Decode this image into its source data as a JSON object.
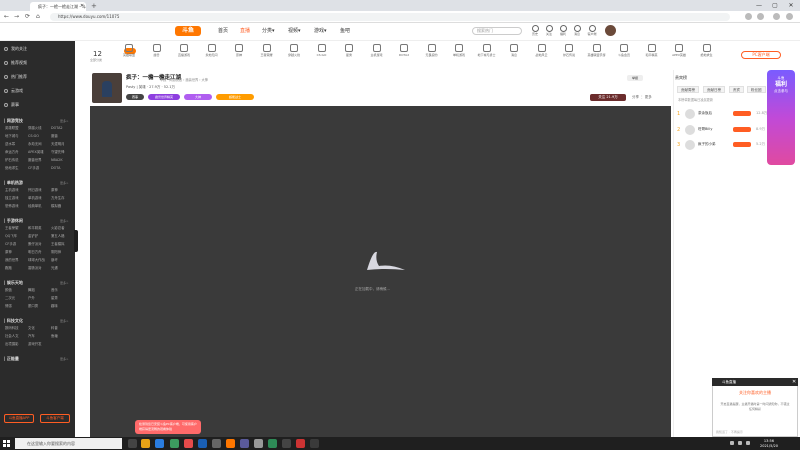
{
  "browser": {
    "tab_title": "疯子：一檐一檐走江湖 - 斗鱼直播",
    "new_tab_label": "+",
    "url": "https://www.douyu.com/11075",
    "window_controls": [
      "—",
      "▢",
      "✕"
    ],
    "nav": [
      "←",
      "→",
      "⟳",
      "⌂"
    ]
  },
  "header": {
    "logo": "斗鱼",
    "nav": [
      {
        "label": "首页",
        "active": false
      },
      {
        "label": "直播",
        "active": true
      },
      {
        "label": "分类▾",
        "active": false
      },
      {
        "label": "视频▾",
        "active": false
      },
      {
        "label": "游戏▾",
        "active": false
      },
      {
        "label": "鱼吧",
        "active": false
      }
    ],
    "search_placeholder": "搜索热门",
    "icons": [
      {
        "icon": "history-icon",
        "label": "历史"
      },
      {
        "icon": "follow-icon",
        "label": "关注"
      },
      {
        "icon": "gift-icon",
        "label": "福利"
      },
      {
        "icon": "message-icon",
        "label": "消息"
      },
      {
        "icon": "download-icon",
        "label": "客户端"
      },
      {
        "icon": "upload-icon",
        "label": "创作中心"
      }
    ]
  },
  "sidebar": {
    "top": [
      "我的关注",
      "推荐视频",
      "热门推荐",
      "云游戏",
      "赛事"
    ],
    "sections": [
      {
        "title": "网游竞技",
        "more": "更多>",
        "items": [
          "英雄联盟",
          "穿越火线",
          "DOTA2",
          "地下城与",
          "CS:GO",
          "魔兽",
          "逆水寒",
          "永劫无间",
          "天涯明月",
          "命运方舟",
          "APEX英雄",
          "守望先锋",
          "炉石传说",
          "魔兽世界",
          "NBA2K",
          "绝地求生",
          "CF手游",
          "DOTA"
        ]
      },
      {
        "title": "单机热游",
        "more": "更多>",
        "items": [
          "主机游戏",
          "怀旧游戏",
          "原神",
          "独立游戏",
          "单机游戏",
          "方舟生存",
          "恐怖游戏",
          "经典单机",
          "模拟器"
        ]
      },
      {
        "title": "手游休闲",
        "more": "更多>",
        "items": [
          "王者荣耀",
          "和平精英",
          "火影忍者",
          "QQ飞车",
          "金铲铲",
          "第五人格",
          "CF手游",
          "蛋仔派对",
          "王者模拟",
          "原神",
          "明日方舟",
          "阴阳师",
          "我的世界",
          "球球大作战",
          "崩坏",
          "跑跑",
          "香肠派对",
          "光遇"
        ]
      },
      {
        "title": "娱乐天地",
        "more": "更多>",
        "items": [
          "颜值",
          "舞蹈",
          "音乐",
          "二次元",
          "户外",
          "星秀",
          "情感",
          "脱口秀",
          "趣味"
        ]
      },
      {
        "title": "科技文化",
        "more": "更多>",
        "items": [
          "数码科技",
          "文化",
          "科普",
          "社会人文",
          "汽车",
          "鱼塘",
          "出境摄影",
          "游戏开发"
        ]
      },
      {
        "title": "正能量",
        "more": "更多>",
        "items": []
      }
    ],
    "buttons": [
      "斗鱼直播APP",
      "斗鱼客户端"
    ]
  },
  "categories": {
    "count_num": "12",
    "count_label": "全部分类",
    "items": [
      "英雄联盟",
      "魔兽",
      "直播游戏",
      "永劫无间",
      "原神",
      "王者荣耀",
      "穿越火线",
      "CS:GO",
      "星秀",
      "主机游戏",
      "DOTA2",
      "无畏契约",
      "单机游戏",
      "地下城与勇士",
      "消息",
      "战地风云",
      "炉石传说",
      "英雄联盟手游",
      "斗鱼会员",
      "和平精英",
      "APEX英雄",
      "绝地求生"
    ],
    "pc_app": "PC客户端"
  },
  "room": {
    "title": "疯子：一檐一檐走江湖",
    "meta": "举报 · 网游竞技 › 魔兽世界 › 大神",
    "anchor": "Pasty | 英雄 · 27.9万 · 52.1万",
    "tags": [
      "赛事",
      "魔兽世界精英",
      "大神",
      "超能战士"
    ],
    "report": "举报",
    "follow": "关注 21.9万",
    "share": "分享 ⋮ 更多"
  },
  "player": {
    "loading_text": "正在加载中，请稍候..."
  },
  "chat": {
    "heading": "贵宾榜",
    "tabs": [
      "贡献周榜",
      "贡献日榜",
      "贵宾",
      "粉丝团"
    ],
    "notice": "本榜单数据每日凌晨更新",
    "fans": [
      {
        "rank": "1",
        "name": "茶余饭后",
        "value": "12.8万"
      },
      {
        "rank": "2",
        "name": "旺哥Billy",
        "value": "8.9万"
      },
      {
        "rank": "3",
        "name": "疯子的小弟",
        "value": "5.2万"
      }
    ]
  },
  "promo": {
    "line1": "斗鱼",
    "line2": "福利",
    "line3": "点击参与"
  },
  "popup": {
    "header": "斗鱼直播",
    "title": "关注你喜欢的主播",
    "body": "开启直播提醒，主播开播时第一时间通知你，不错过任何精彩",
    "footer": "我知道了 · 不再提示"
  },
  "toast": {
    "text": "检测到您已安装斗鱼PC客户端，可使用客户端获得更流畅的观看体验"
  },
  "taskbar": {
    "search_placeholder": "在这里输入你要搜索的内容",
    "time": "13:56",
    "date": "2021/5/20"
  }
}
